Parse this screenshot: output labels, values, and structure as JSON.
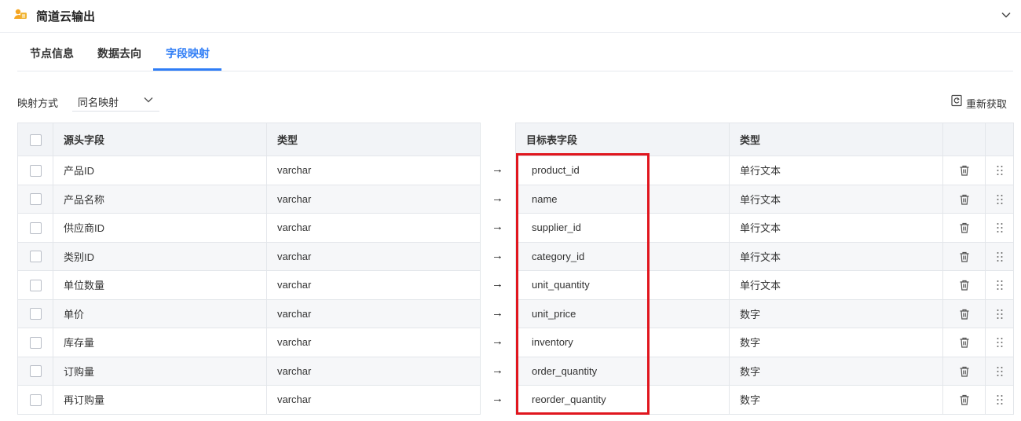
{
  "header": {
    "title": "简道云输出",
    "logo_icon": "jdy-logo-icon",
    "collapse_icon": "chevron-down-icon"
  },
  "tabs": [
    {
      "label": "节点信息",
      "active": false
    },
    {
      "label": "数据去向",
      "active": false
    },
    {
      "label": "字段映射",
      "active": true
    }
  ],
  "mapping": {
    "label": "映射方式",
    "value": "同名映射"
  },
  "refetch": {
    "label": "重新获取",
    "icon": "refresh-icon"
  },
  "source_table": {
    "headers": {
      "field": "源头字段",
      "type": "类型"
    },
    "rows": [
      {
        "field": "产品ID",
        "type": "varchar"
      },
      {
        "field": "产品名称",
        "type": "varchar"
      },
      {
        "field": "供应商ID",
        "type": "varchar"
      },
      {
        "field": "类别ID",
        "type": "varchar"
      },
      {
        "field": "单位数量",
        "type": "varchar"
      },
      {
        "field": "单价",
        "type": "varchar"
      },
      {
        "field": "库存量",
        "type": "varchar"
      },
      {
        "field": "订购量",
        "type": "varchar"
      },
      {
        "field": "再订购量",
        "type": "varchar"
      }
    ]
  },
  "arrow_glyph": "→",
  "target_table": {
    "headers": {
      "field": "目标表字段",
      "type": "类型"
    },
    "rows": [
      {
        "field": "product_id",
        "type": "单行文本"
      },
      {
        "field": "name",
        "type": "单行文本"
      },
      {
        "field": "supplier_id",
        "type": "单行文本"
      },
      {
        "field": "category_id",
        "type": "单行文本"
      },
      {
        "field": "unit_quantity",
        "type": "单行文本"
      },
      {
        "field": "unit_price",
        "type": "数字"
      },
      {
        "field": "inventory",
        "type": "数字"
      },
      {
        "field": "order_quantity",
        "type": "数字"
      },
      {
        "field": "reorder_quantity",
        "type": "数字"
      }
    ]
  },
  "colors": {
    "accent": "#2f7df6",
    "highlight": "#e0161e",
    "header_bg": "#f2f4f7"
  }
}
